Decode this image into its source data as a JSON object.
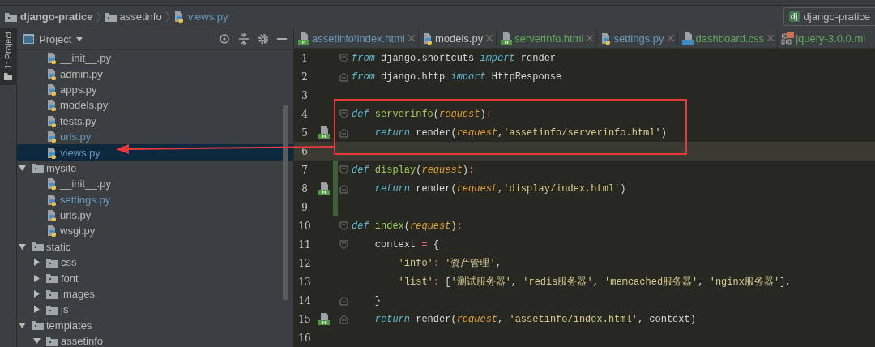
{
  "breadcrumb": [
    {
      "label": "django-pratice",
      "kind": "project"
    },
    {
      "label": "assetinfo",
      "kind": "folder"
    },
    {
      "label": "views.py",
      "kind": "python"
    }
  ],
  "run_config": {
    "logo_text": "dj",
    "label": "django-pratice"
  },
  "side_tab": {
    "label": "1: Project"
  },
  "project_panel": {
    "title": "Project"
  },
  "tree_cut_children": [
    {
      "name": "__init__.py",
      "kind": "python",
      "modified": false,
      "selected": false
    },
    {
      "name": "admin.py",
      "kind": "python",
      "modified": false,
      "selected": false
    },
    {
      "name": "apps.py",
      "kind": "python",
      "modified": false,
      "selected": false
    },
    {
      "name": "models.py",
      "kind": "python",
      "modified": false,
      "selected": false
    },
    {
      "name": "tests.py",
      "kind": "python",
      "modified": false,
      "selected": false
    },
    {
      "name": "urls.py",
      "kind": "python",
      "modified": true,
      "selected": false
    },
    {
      "name": "views.py",
      "kind": "python",
      "modified": true,
      "selected": true
    }
  ],
  "tree": [
    {
      "name": "mysite",
      "kind": "folder",
      "expanded": true,
      "children": [
        {
          "name": "__init__.py",
          "kind": "python",
          "modified": false,
          "selected": false
        },
        {
          "name": "settings.py",
          "kind": "python",
          "modified": true,
          "selected": false
        },
        {
          "name": "urls.py",
          "kind": "python",
          "modified": false,
          "selected": false
        },
        {
          "name": "wsgi.py",
          "kind": "python",
          "modified": false,
          "selected": false
        }
      ]
    },
    {
      "name": "static",
      "kind": "folder",
      "expanded": true,
      "children": [
        {
          "name": "css",
          "kind": "folder",
          "expanded": false
        },
        {
          "name": "font",
          "kind": "folder",
          "expanded": false
        },
        {
          "name": "images",
          "kind": "folder",
          "expanded": false
        },
        {
          "name": "js",
          "kind": "folder",
          "expanded": false
        }
      ]
    },
    {
      "name": "templates",
      "kind": "folder",
      "expanded": true,
      "children": [
        {
          "name": "assetinfo",
          "kind": "folder",
          "expanded": true
        }
      ]
    }
  ],
  "tabs": [
    {
      "label": "assetinfo\\index.html",
      "kind": "html",
      "modified": true,
      "added": false
    },
    {
      "label": "models.py",
      "kind": "python",
      "modified": false,
      "added": false
    },
    {
      "label": "serverinfo.html",
      "kind": "html",
      "modified": false,
      "added": true
    },
    {
      "label": "settings.py",
      "kind": "python",
      "modified": true,
      "added": false
    },
    {
      "label": "dashboard.css",
      "kind": "css",
      "modified": false,
      "added": true
    },
    {
      "label": "jquery-3.0.0.mi",
      "kind": "js",
      "modified": false,
      "added": true
    }
  ],
  "code": [
    {
      "number": "1",
      "fold_start": true,
      "tokens": [
        {
          "kind": "kw",
          "text": "from "
        },
        {
          "kind": "plain",
          "text": "django.shortcuts "
        },
        {
          "kind": "kw",
          "text": "import "
        },
        {
          "kind": "plain",
          "text": "render"
        }
      ]
    },
    {
      "number": "2",
      "fold_end": true,
      "tokens": [
        {
          "kind": "kw",
          "text": "from "
        },
        {
          "kind": "plain",
          "text": "django.http "
        },
        {
          "kind": "kw",
          "text": "import "
        },
        {
          "kind": "plain",
          "text": "HttpResponse"
        }
      ]
    },
    {
      "number": "3"
    },
    {
      "number": "4",
      "fold_start": true,
      "tokens": [
        {
          "kind": "kw",
          "text": "def "
        },
        {
          "kind": "fn",
          "text": "serverinfo"
        },
        {
          "kind": "plain",
          "text": "("
        },
        {
          "kind": "param",
          "text": "request"
        },
        {
          "kind": "plain",
          "text": ")"
        },
        {
          "kind": "punct",
          "text": ":"
        }
      ]
    },
    {
      "number": "5",
      "fold_end": true,
      "template_link": true,
      "tokens": [
        {
          "kind": "kw",
          "text": "    return "
        },
        {
          "kind": "plain",
          "text": "render("
        },
        {
          "kind": "param",
          "text": "request"
        },
        {
          "kind": "plain",
          "text": ","
        },
        {
          "kind": "str",
          "text": "'assetinfo/serverinfo.html'"
        },
        {
          "kind": "plain",
          "text": ")"
        }
      ]
    },
    {
      "number": "6",
      "current": true
    },
    {
      "number": "7",
      "fold_start": true,
      "changed": true,
      "tokens": [
        {
          "kind": "kw",
          "text": "def "
        },
        {
          "kind": "fn",
          "text": "display"
        },
        {
          "kind": "plain",
          "text": "("
        },
        {
          "kind": "param",
          "text": "request"
        },
        {
          "kind": "plain",
          "text": ")"
        },
        {
          "kind": "punct",
          "text": ":"
        }
      ]
    },
    {
      "number": "8",
      "fold_end": true,
      "template_link": true,
      "changed": true,
      "tokens": [
        {
          "kind": "kw",
          "text": "    return "
        },
        {
          "kind": "plain",
          "text": "render("
        },
        {
          "kind": "param",
          "text": "request"
        },
        {
          "kind": "plain",
          "text": ","
        },
        {
          "kind": "str",
          "text": "'display/index.html'"
        },
        {
          "kind": "plain",
          "text": ")"
        }
      ]
    },
    {
      "number": "9",
      "changed": true
    },
    {
      "number": "10",
      "fold_start": true,
      "tokens": [
        {
          "kind": "kw",
          "text": "def "
        },
        {
          "kind": "fn",
          "text": "index"
        },
        {
          "kind": "plain",
          "text": "("
        },
        {
          "kind": "param",
          "text": "request"
        },
        {
          "kind": "plain",
          "text": ")"
        },
        {
          "kind": "punct",
          "text": ":"
        }
      ]
    },
    {
      "number": "11",
      "fold_start": true,
      "tokens": [
        {
          "kind": "plain",
          "text": "    context "
        },
        {
          "kind": "punct",
          "text": "="
        },
        {
          "kind": "plain",
          "text": " {"
        }
      ]
    },
    {
      "number": "12",
      "tokens": [
        {
          "kind": "str",
          "text": "        'info'"
        },
        {
          "kind": "punct",
          "text": ":"
        },
        {
          "kind": "str",
          "text": " '资产管理'"
        },
        {
          "kind": "plain",
          "text": ","
        }
      ]
    },
    {
      "number": "13",
      "tokens": [
        {
          "kind": "str",
          "text": "        'list'"
        },
        {
          "kind": "punct",
          "text": ":"
        },
        {
          "kind": "plain",
          "text": " ["
        },
        {
          "kind": "str",
          "text": "'测试服务器'"
        },
        {
          "kind": "plain",
          "text": ", "
        },
        {
          "kind": "str",
          "text": "'redis服务器'"
        },
        {
          "kind": "plain",
          "text": ", "
        },
        {
          "kind": "str",
          "text": "'memcached服务器'"
        },
        {
          "kind": "plain",
          "text": ", "
        },
        {
          "kind": "str",
          "text": "'nginx服务器'"
        },
        {
          "kind": "plain",
          "text": "],"
        }
      ]
    },
    {
      "number": "14",
      "fold_end": true,
      "tokens": [
        {
          "kind": "plain",
          "text": "    }"
        }
      ]
    },
    {
      "number": "15",
      "fold_end": true,
      "template_link": true,
      "tokens": [
        {
          "kind": "kw",
          "text": "    return "
        },
        {
          "kind": "plain",
          "text": "render("
        },
        {
          "kind": "param",
          "text": "request"
        },
        {
          "kind": "plain",
          "text": ", "
        },
        {
          "kind": "str",
          "text": "'assetinfo/index.html'"
        },
        {
          "kind": "plain",
          "text": ", context)"
        }
      ]
    },
    {
      "number": "16"
    }
  ]
}
